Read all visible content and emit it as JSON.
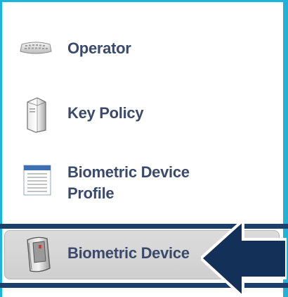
{
  "menu": {
    "items": [
      {
        "label": "Operator",
        "icon": "keyboard-icon"
      },
      {
        "label": "Key Policy",
        "icon": "server-tower-icon"
      },
      {
        "label": "Biometric Device Profile",
        "icon": "document-list-icon"
      },
      {
        "label": "Biometric Device",
        "icon": "biometric-reader-icon",
        "selected": true
      }
    ]
  },
  "colors": {
    "frame": "#1eb3da",
    "label": "#3b4a6b",
    "selection_band": "#1b3f6b",
    "selected_bg": "#d6d6d6",
    "arrow": "#133158"
  }
}
